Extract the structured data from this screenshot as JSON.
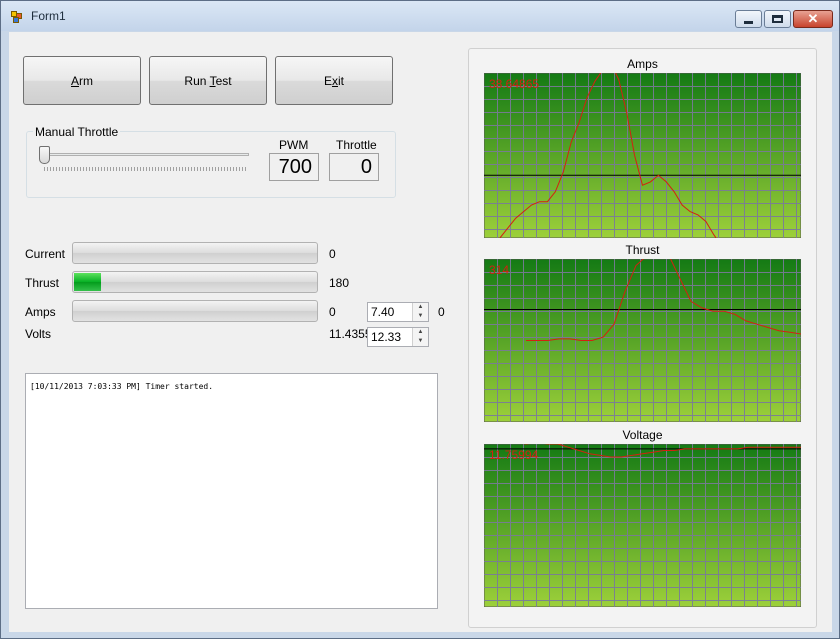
{
  "window": {
    "title": "Form1"
  },
  "buttons": {
    "arm": "Arm",
    "run_test": "Run Test",
    "exit": "Exit"
  },
  "throttle_group": {
    "label": "Manual Throttle",
    "pwm_label": "PWM",
    "pwm_value": "700",
    "throttle_label": "Throttle",
    "throttle_value": "0",
    "slider_position": 0
  },
  "meters": [
    {
      "label": "Current",
      "value": "0",
      "fill": 0
    },
    {
      "label": "Thrust",
      "value": "180",
      "fill": 0.11
    },
    {
      "label": "Amps",
      "value": "0",
      "fill": 0
    },
    {
      "label": "Volts",
      "value": "11.4355"
    }
  ],
  "spinners": [
    {
      "value": "7.40",
      "side_value": "0"
    },
    {
      "value": "12.33"
    }
  ],
  "log": {
    "lines": [
      "[10/11/2013 7:03:33 PM] Timer started."
    ]
  },
  "colors": {
    "plot_top": "#147a14",
    "plot_bottom": "#9dd03a",
    "grid": "#7a7a9a",
    "series": "#d42010",
    "baseline": "#000000"
  },
  "chart_data": [
    {
      "type": "line",
      "title": "Amps",
      "readout": "38.64865",
      "ylim": [
        0,
        1
      ],
      "baseline": 0.38,
      "x": [
        0,
        1,
        2,
        3,
        4,
        5,
        6,
        7,
        8,
        9,
        10,
        11,
        12,
        13,
        14,
        15,
        16,
        17,
        18,
        19,
        20,
        21,
        22,
        23,
        24,
        25,
        26,
        27,
        28,
        29,
        30,
        31,
        32,
        33,
        34,
        35,
        36,
        37,
        38,
        39,
        40
      ],
      "values": [
        -0.1,
        -0.06,
        0,
        0.06,
        0.12,
        0.16,
        0.2,
        0.22,
        0.22,
        0.28,
        0.4,
        0.58,
        0.7,
        0.85,
        0.95,
        1.02,
        1.06,
        0.96,
        0.76,
        0.5,
        0.32,
        0.34,
        0.38,
        0.34,
        0.28,
        0.2,
        0.16,
        0.14,
        0.1,
        0.02,
        -0.05,
        -0.08,
        -0.1,
        -0.1,
        -0.1,
        -0.1,
        -0.1,
        -0.1,
        -0.1,
        -0.1,
        -0.1
      ]
    },
    {
      "type": "line",
      "title": "Thrust",
      "readout": "314",
      "ylim": [
        0,
        1
      ],
      "baseline": 0.69,
      "x": [
        0,
        1,
        2,
        3,
        4,
        5,
        6,
        7,
        8,
        9,
        10,
        11,
        12,
        13,
        14,
        15,
        16,
        17,
        18,
        19,
        20,
        21,
        22,
        23,
        24,
        25
      ],
      "values": [
        0.5,
        0.5,
        0.5,
        0.51,
        0.51,
        0.5,
        0.5,
        0.52,
        0.6,
        0.8,
        0.96,
        1.02,
        1.04,
        1.02,
        0.88,
        0.74,
        0.7,
        0.68,
        0.68,
        0.66,
        0.62,
        0.6,
        0.58,
        0.56,
        0.55,
        0.54
      ]
    },
    {
      "type": "line",
      "title": "Voltage",
      "readout": "11.75994",
      "ylim": [
        0,
        1
      ],
      "baseline": 0.97,
      "x": [
        0,
        1,
        2,
        3,
        4,
        5,
        6,
        7,
        8,
        9,
        10,
        11,
        12,
        13,
        14,
        15,
        16,
        17,
        18,
        19,
        20,
        21,
        22,
        23,
        24,
        25,
        26,
        27,
        28,
        29,
        30
      ],
      "values": [
        1.02,
        1.02,
        1.01,
        1.01,
        1.0,
        1.01,
        1.0,
        1.0,
        0.98,
        0.96,
        0.94,
        0.93,
        0.92,
        0.92,
        0.93,
        0.94,
        0.95,
        0.96,
        0.96,
        0.97,
        0.97,
        0.97,
        0.97,
        0.97,
        0.97,
        0.98,
        0.98,
        0.98,
        0.98,
        0.98,
        0.98
      ]
    }
  ]
}
